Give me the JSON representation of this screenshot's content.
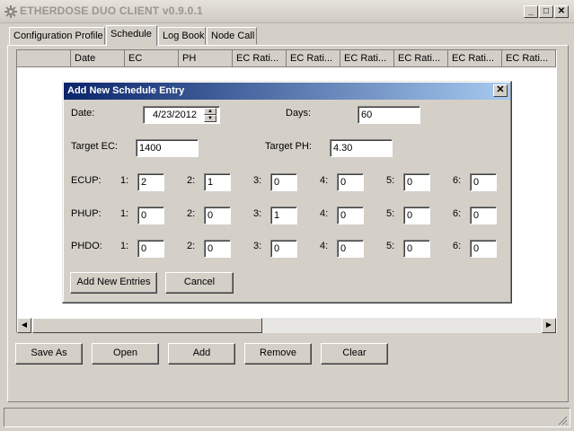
{
  "window": {
    "title": "ETHERDOSE DUO CLIENT v0.9.0.1",
    "minimize": "_",
    "maximize": "□",
    "close": "✕"
  },
  "tabs": [
    {
      "label": "Configuration Profile",
      "active": false
    },
    {
      "label": "Schedule",
      "active": true
    },
    {
      "label": "Log Book",
      "active": false
    },
    {
      "label": "Node Call",
      "active": false
    }
  ],
  "grid": {
    "columns": [
      "",
      "Date",
      "EC",
      "PH",
      "EC Rati...",
      "EC Rati...",
      "EC Rati...",
      "EC Rati...",
      "EC Rati...",
      "EC Rati..."
    ],
    "rows": []
  },
  "bottom_buttons": {
    "save_as": "Save As",
    "open": "Open",
    "add": "Add",
    "remove": "Remove",
    "clear": "Clear"
  },
  "dialog": {
    "title": "Add New Schedule Entry",
    "close": "✕",
    "date_label": "Date:",
    "date_value": "4/23/2012",
    "days_label": "Days:",
    "days_value": "60",
    "target_ec_label": "Target EC:",
    "target_ec_value": "1400",
    "target_ph_label": "Target PH:",
    "target_ph_value": "4.30",
    "pump_rows": [
      {
        "label": "ECUP:",
        "values": [
          "2",
          "1",
          "0",
          "0",
          "0",
          "0"
        ]
      },
      {
        "label": "PHUP:",
        "values": [
          "0",
          "0",
          "1",
          "0",
          "0",
          "0"
        ]
      },
      {
        "label": "PHDO:",
        "values": [
          "0",
          "0",
          "0",
          "0",
          "0",
          "0"
        ]
      }
    ],
    "pump_numbers": [
      "1:",
      "2:",
      "3:",
      "4:",
      "5:",
      "6:"
    ],
    "add_button": "Add New Entries",
    "cancel_button": "Cancel"
  }
}
